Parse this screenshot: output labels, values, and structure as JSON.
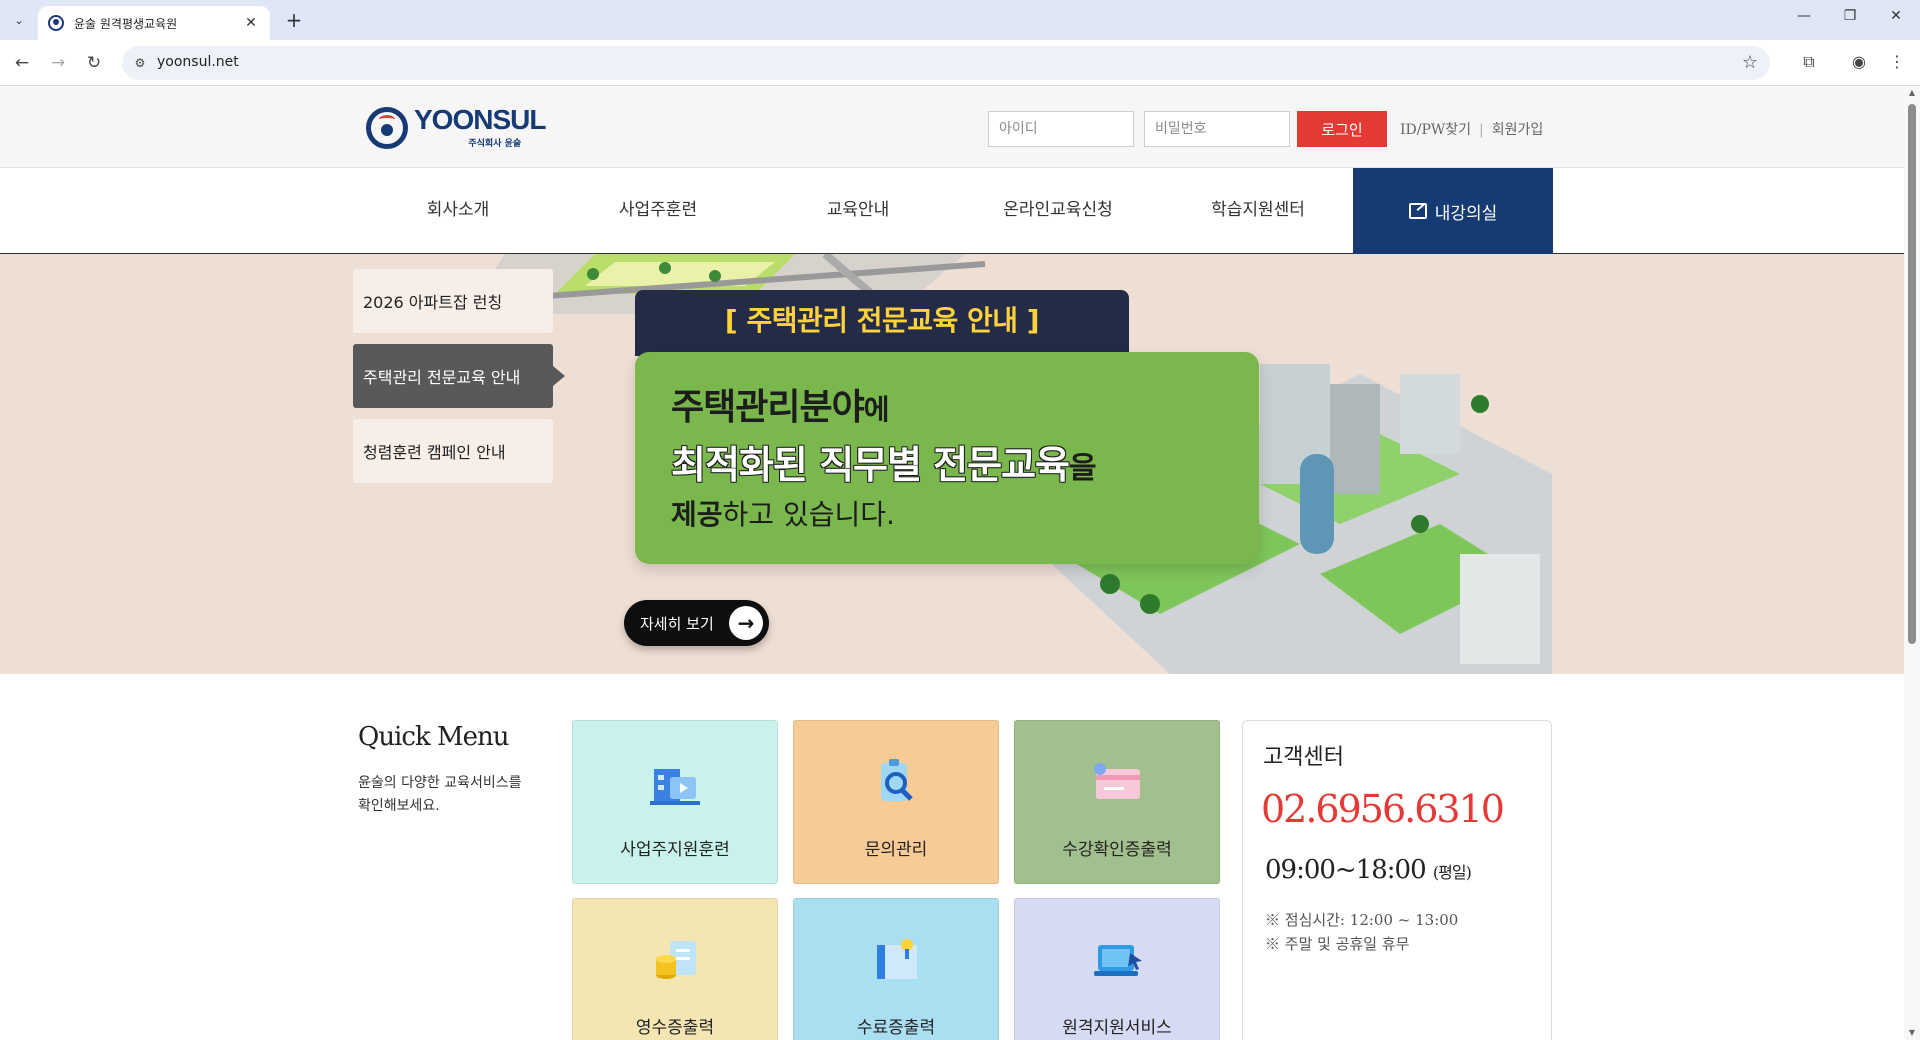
{
  "browser": {
    "tab_title": "윤술 원격평생교육원",
    "url": "yoonsul.net"
  },
  "header": {
    "logo_text": "YOONSUL",
    "logo_sub": "주식회사 윤술",
    "id_placeholder": "아이디",
    "pw_placeholder": "비밀번호",
    "login_label": "로그인",
    "find_label": "ID/PW찾기",
    "join_label": "회원가입",
    "brand_color": "#163a73",
    "accent_color": "#e53935"
  },
  "gnb": {
    "items": [
      "회사소개",
      "사업주훈련",
      "교육안내",
      "온라인교육신청",
      "학습지원센터"
    ],
    "lecture_label": "내강의실"
  },
  "hero": {
    "tabs": [
      "2026 아파트잡 런칭",
      "주택관리 전문교육 안내",
      "청렴훈련 캠페인 안내"
    ],
    "active_tab": 1,
    "banner_title": "[ 주택관리 전문교육 안내 ]",
    "line1_bold": "주택관리분야",
    "line1_rest": "에",
    "line2_bold": "최적화된 직무별 전문교육",
    "line2_rest": "을",
    "line3_bold": "제공",
    "line3_rest": "하고 있습니다.",
    "more_label": "자세히 보기"
  },
  "quick_menu": {
    "title": "Quick Menu",
    "desc": "윤술의 다양한 교육서비스를 확인해보세요.",
    "items": [
      {
        "label": "사업주지원훈련",
        "icon": "building-icon",
        "color": "#c9f2ec"
      },
      {
        "label": "문의관리",
        "icon": "magnify-clipboard-icon",
        "color": "#f6cb95"
      },
      {
        "label": "수강확인증출력",
        "icon": "card-icon",
        "color": "#a2c08d"
      },
      {
        "label": "영수증출력",
        "icon": "coins-receipt-icon",
        "color": "#f4e6b3"
      },
      {
        "label": "수료증출력",
        "icon": "certificate-icon",
        "color": "#a9dff0"
      },
      {
        "label": "원격지원서비스",
        "icon": "laptop-remote-icon",
        "color": "#d6dbf3"
      }
    ]
  },
  "customer_center": {
    "title": "고객센터",
    "phone": "02.6956.6310",
    "hours": "09:00~18:00",
    "hours_note": "(평일)",
    "lunch": "※ 점심시간: 12:00 ~ 13:00",
    "holiday": "※ 주말 및 공휴일 휴무"
  }
}
